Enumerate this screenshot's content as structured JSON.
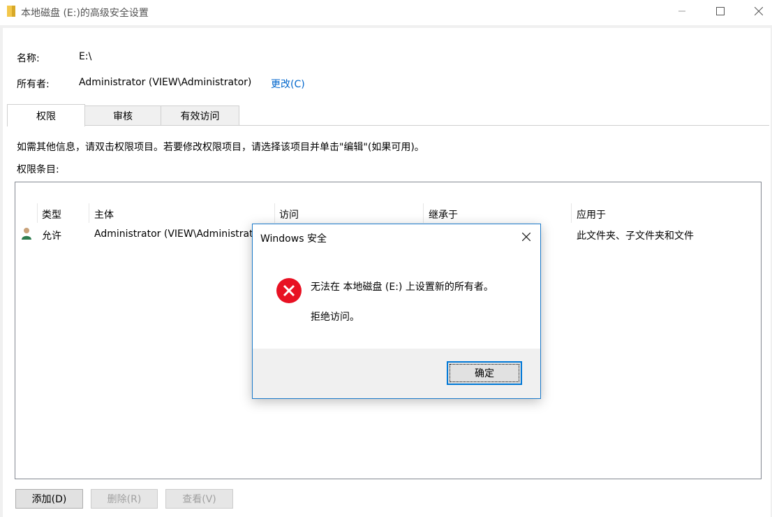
{
  "window": {
    "title": "本地磁盘 (E:)的高级安全设置"
  },
  "info": {
    "name_label": "名称:",
    "name_value": "E:\\",
    "owner_label": "所有者:",
    "owner_value": "Administrator (VIEW\\Administrator)",
    "change_link": "更改(C)"
  },
  "tabs": [
    {
      "label": "权限"
    },
    {
      "label": "审核"
    },
    {
      "label": "有效访问"
    }
  ],
  "description": "如需其他信息，请双击权限项目。若要修改权限项目，请选择该项目并单击\"编辑\"(如果可用)。",
  "entries_label": "权限条目:",
  "table": {
    "columns": [
      "类型",
      "主体",
      "访问",
      "继承于",
      "应用于"
    ],
    "rows": [
      {
        "icon": "user-icon",
        "type": "允许",
        "principal": "Administrator (VIEW\\Administrator)",
        "access": "",
        "inherited_from": "",
        "applies_to": "此文件夹、子文件夹和文件"
      }
    ]
  },
  "buttons": {
    "add": "添加(D)",
    "remove": "删除(R)",
    "view": "查看(V)"
  },
  "dialog": {
    "title": "Windows 安全",
    "message": "无法在 本地磁盘 (E:) 上设置新的所有者。",
    "detail": "拒绝访问。",
    "ok": "确定",
    "icon": "error-icon"
  },
  "colors": {
    "link": "#0066cc",
    "error_red": "#e81123",
    "dialog_border": "#1979ca",
    "user_icon_green": "#2e7d4f"
  }
}
